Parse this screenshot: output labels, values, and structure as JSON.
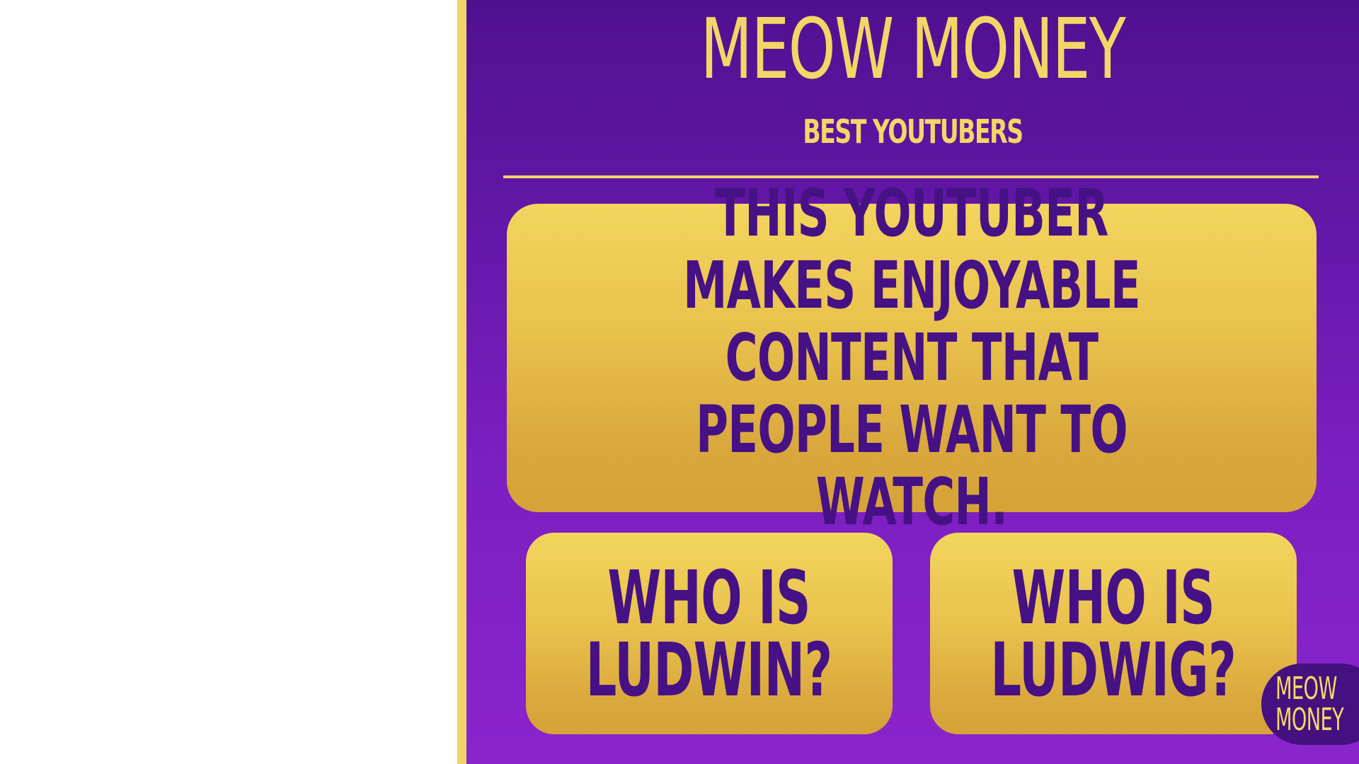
{
  "game": {
    "title": "MEOW MONEY",
    "category": "BEST YOUTUBERS",
    "clue": "THIS YOUTUBER MAKES ENJOYABLE CONTENT THAT PEOPLE WANT TO WATCH.",
    "answers": [
      {
        "label": "WHO IS\nLUDWIN?"
      },
      {
        "label": "WHO IS\nLUDWIG?"
      }
    ],
    "logo_text": "MEOW\nMONEY"
  },
  "colors": {
    "purple_dark": "#4f1190",
    "purple_light": "#8a25cc",
    "gold": "#f3d766",
    "gold_dark": "#d6a338",
    "text_purple": "#461184"
  }
}
